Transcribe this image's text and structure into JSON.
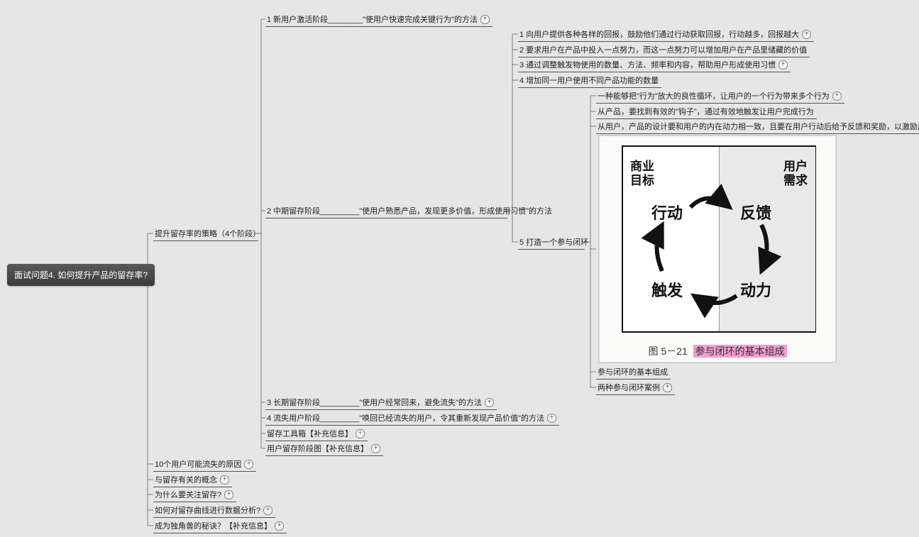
{
  "root": {
    "label": "面试问题4. 如何提升产品的留存率?"
  },
  "level1": {
    "strategy": "提升留存率的策略（4个阶段）",
    "reasons": "10个用户可能流失的原因",
    "concepts": "与留存有关的概念",
    "why": "为什么要关注留存?",
    "curve": "如何对留存曲线进行数据分析?",
    "unicorn": "成为独角兽的秘诀？【补充信息】"
  },
  "strategy_children": {
    "s1": "1 新用户激活阶段________\"使用户快速完成关键行为\"的方法",
    "s2": "2 中期留存阶段_________\"使用户熟悉产品，发现更多价值，形成使用习惯\"的方法",
    "s3": "3 长期留存阶段_________\"使用户经常回来，避免流失\"的方法",
    "s4": "4 流失用户阶段_________\"唤回已经流失的用户，令其重新发现产品价值\"的方法",
    "s5": "留存工具箱【补充信息】",
    "s6": "用户留存阶段图【补充信息】"
  },
  "mid_children": {
    "m1": "1 向用户提供各种各样的回报，鼓励他们通过行动获取回报，行动越多，回报越大",
    "m2": "2 要求用户在产品中投入一点努力，而这一点努力可以增加用户在产品里储藏的价值",
    "m3": "3 通过调整触发物使用的数量、方法、频率和内容，帮助用户形成使用习惯",
    "m4": "4 增加同一用户使用不同产品功能的数量",
    "m5": "5 打造一个参与闭环"
  },
  "loop_children": {
    "l1": "一种能够把\"行为\"放大的良性循环，让用户的一个行为带来多个行为",
    "l2": "从产品，要找到有效的\"钩子\"，通过有效地触发让用户完成行为",
    "l3": "从用户，产品的设计要和用户的内在动力相一致，且要在用户行动后给予反馈和奖励，以激励用户下一次行动",
    "l4": "参与闭环的基本组成",
    "l5": "两种参与闭环案例"
  },
  "expand_glyph": "+",
  "image": {
    "biz_goal": "商业\n目标",
    "user_need": "用户\n需求",
    "action": "行动",
    "feedback": "反馈",
    "trigger": "触发",
    "motivation": "动力",
    "fig_num": "图 5－21",
    "fig_title": "参与闭环的基本组成"
  },
  "chart_data": {
    "type": "mindmap",
    "title": "面试问题4. 如何提升产品的留存率?",
    "root": "面试问题4. 如何提升产品的留存率?",
    "children": [
      {
        "label": "提升留存率的策略（4个阶段）",
        "children": [
          {
            "label": "1 新用户激活阶段 —— \"使用户快速完成关键行为\"的方法",
            "collapsed": true
          },
          {
            "label": "2 中期留存阶段 —— \"使用户熟悉产品，发现更多价值，形成使用习惯\"的方法",
            "children": [
              {
                "label": "1 向用户提供各种各样的回报，鼓励他们通过行动获取回报，行动越多，回报越大",
                "collapsed": true
              },
              {
                "label": "2 要求用户在产品中投入一点努力，而这一点努力可以增加用户在产品里储藏的价值"
              },
              {
                "label": "3 通过调整触发物使用的数量、方法、频率和内容，帮助用户形成使用习惯",
                "collapsed": true
              },
              {
                "label": "4 增加同一用户使用不同产品功能的数量"
              },
              {
                "label": "5 打造一个参与闭环",
                "children": [
                  {
                    "label": "一种能够把\"行为\"放大的良性循环，让用户的一个行为带来多个行为",
                    "collapsed": true
                  },
                  {
                    "label": "从产品，要找到有效的\"钩子\"，通过有效地触发让用户完成行为"
                  },
                  {
                    "label": "从用户，产品的设计要和用户的内在动力相一致，且要在用户行动后给予反馈和奖励，以激励用户下一次行动"
                  },
                  {
                    "label": "参与闭环的基本组成",
                    "image": "图5-21 参与闭环的基本组成 (商业目标→行动→触发→动力→反馈→用户需求 循环)"
                  },
                  {
                    "label": "两种参与闭环案例",
                    "collapsed": true
                  }
                ]
              }
            ]
          },
          {
            "label": "3 长期留存阶段 —— \"使用户经常回来，避免流失\"的方法",
            "collapsed": true
          },
          {
            "label": "4 流失用户阶段 —— \"唤回已经流失的用户，令其重新发现产品价值\"的方法",
            "collapsed": true
          },
          {
            "label": "留存工具箱【补充信息】",
            "collapsed": true
          },
          {
            "label": "用户留存阶段图【补充信息】",
            "collapsed": true
          }
        ]
      },
      {
        "label": "10个用户可能流失的原因",
        "collapsed": true
      },
      {
        "label": "与留存有关的概念",
        "collapsed": true
      },
      {
        "label": "为什么要关注留存?",
        "collapsed": true
      },
      {
        "label": "如何对留存曲线进行数据分析?",
        "collapsed": true
      },
      {
        "label": "成为独角兽的秘诀？【补充信息】",
        "collapsed": true
      }
    ]
  }
}
